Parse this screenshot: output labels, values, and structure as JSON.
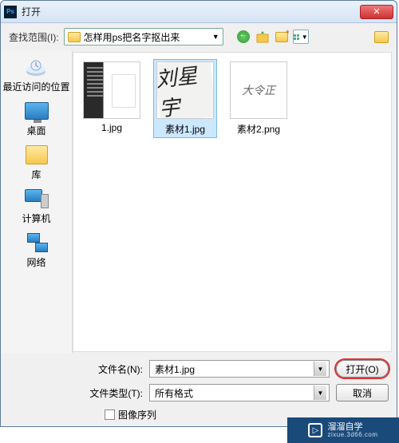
{
  "titlebar": {
    "title": "打开",
    "close": "✕"
  },
  "toolbar": {
    "scope_label": "查找范围(I):",
    "folder_name": "怎样用ps把名字抠出来"
  },
  "sidebar": {
    "items": [
      {
        "label": "最近访问的位置"
      },
      {
        "label": "桌面"
      },
      {
        "label": "库"
      },
      {
        "label": "计算机"
      },
      {
        "label": "网络"
      }
    ]
  },
  "files": {
    "items": [
      {
        "label": "1.jpg"
      },
      {
        "label": "素材1.jpg",
        "preview": "刘星宇"
      },
      {
        "label": "素材2.png",
        "preview": "大令正"
      }
    ]
  },
  "bottom": {
    "filename_label": "文件名(N):",
    "filename_value": "素材1.jpg",
    "filetype_label": "文件类型(T):",
    "filetype_value": "所有格式",
    "open_btn": "打开(O)",
    "cancel_btn": "取消",
    "sequence_label": "图像序列"
  },
  "watermark": {
    "brand": "溜溜自学",
    "url": "zixue.3d66.com"
  }
}
